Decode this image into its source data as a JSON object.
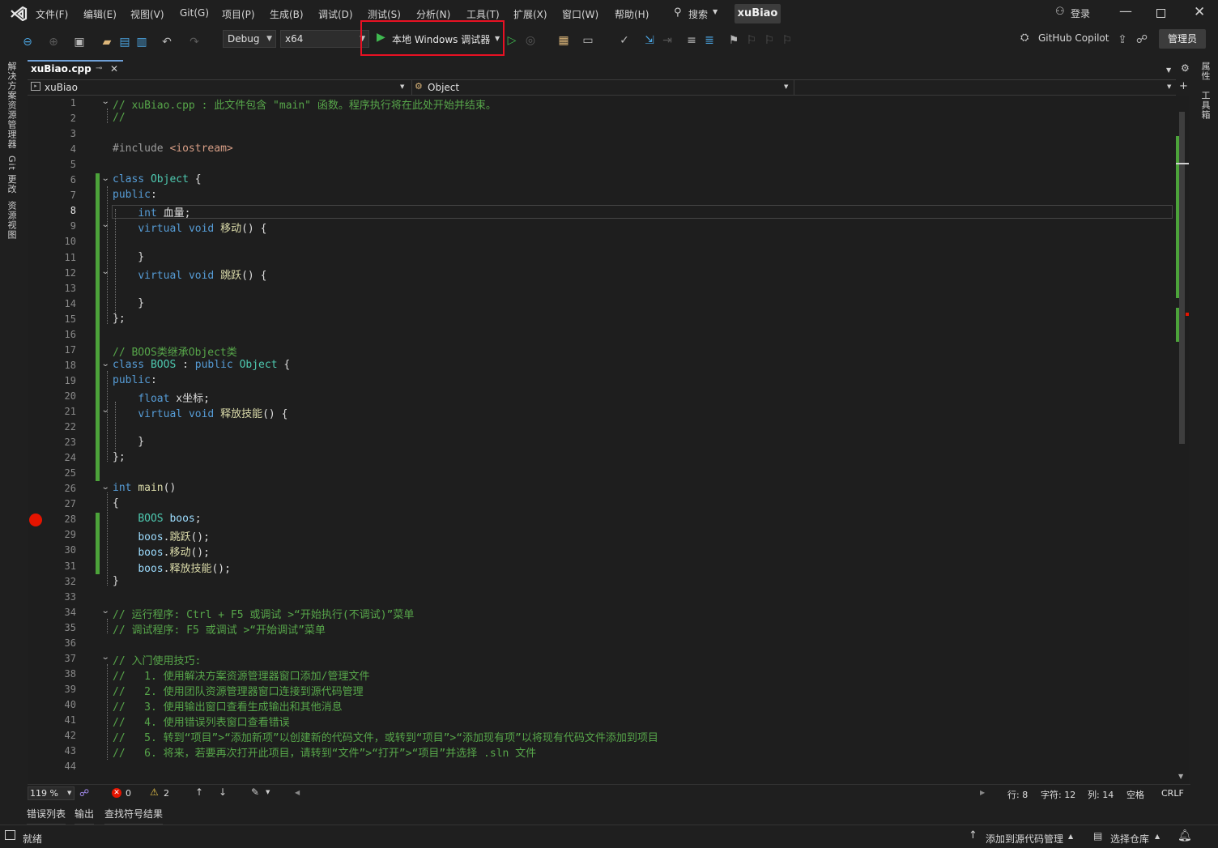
{
  "menu": {
    "items": [
      "文件(F)",
      "编辑(E)",
      "视图(V)",
      "Git(G)",
      "项目(P)",
      "生成(B)",
      "调试(D)",
      "测试(S)",
      "分析(N)",
      "工具(T)",
      "扩展(X)",
      "窗口(W)",
      "帮助(H)"
    ],
    "search_label": "搜索",
    "solution_name": "xuBiao",
    "login_label": "登录"
  },
  "toolbar": {
    "config": "Debug",
    "platform": "x64",
    "run_label": "本地 Windows 调试器",
    "copilot_label": "GitHub Copilot",
    "admin_label": "管理员",
    "highlight_color": "#e81123"
  },
  "left_rail": [
    "解决方案资源管理器",
    "Git 更改",
    "资源视图"
  ],
  "right_rail": [
    "属性",
    "工具箱"
  ],
  "doc_tab": {
    "title": "xuBiao.cpp"
  },
  "navbar": {
    "scope": "xuBiao",
    "member": "Object"
  },
  "code_lines": [
    "// xuBiao.cpp : 此文件包含 \"main\" 函数。程序执行将在此处开始并结束。",
    "//",
    "",
    "#include <iostream>",
    "",
    "class Object {",
    "public:",
    "    int 血量;",
    "    virtual void 移动() {",
    "",
    "    }",
    "    virtual void 跳跃() {",
    "",
    "    }",
    "};",
    "",
    "// BOOS类继承Object类",
    "class BOOS : public Object {",
    "public:",
    "    float x坐标;",
    "    virtual void 释放技能() {",
    "",
    "    }",
    "};",
    "",
    "int main()",
    "{",
    "    BOOS boos;",
    "    boos.跳跃();",
    "    boos.移动();",
    "    boos.释放技能();",
    "}",
    "",
    "// 运行程序: Ctrl + F5 或调试 >“开始执行(不调试)”菜单",
    "// 调试程序: F5 或调试 >“开始调试”菜单",
    "",
    "// 入门使用技巧:",
    "//   1. 使用解决方案资源管理器窗口添加/管理文件",
    "//   2. 使用团队资源管理器窗口连接到源代码管理",
    "//   3. 使用输出窗口查看生成输出和其他消息",
    "//   4. 使用错误列表窗口查看错误",
    "//   5. 转到“项目”>“添加新项”以创建新的代码文件，或转到“项目”>“添加现有项”以将现有代码文件添加到项目",
    "//   6. 将来，若要再次打开此项目，请转到“文件”>“打开”>“项目”并选择 .sln 文件",
    ""
  ],
  "line_numbers": [
    "1",
    "2",
    "3",
    "4",
    "5",
    "6",
    "7",
    "8",
    "9",
    "10",
    "11",
    "12",
    "13",
    "14",
    "15",
    "16",
    "17",
    "18",
    "19",
    "20",
    "21",
    "22",
    "23",
    "24",
    "25",
    "26",
    "27",
    "28",
    "29",
    "30",
    "31",
    "32",
    "33",
    "34",
    "35",
    "36",
    "37",
    "38",
    "39",
    "40",
    "41",
    "42",
    "43",
    "44"
  ],
  "status_line": {
    "zoom": "119 %",
    "errors": "0",
    "warnings": "2",
    "row": "行: 8",
    "char": "字符: 12",
    "col": "列: 14",
    "spaces": "空格",
    "eol": "CRLF"
  },
  "bottom_tabs": [
    "错误列表",
    "输出",
    "查找符号结果"
  ],
  "statusbar": {
    "ready": "就绪",
    "add_source": "添加到源代码管理",
    "select_repo": "选择仓库"
  },
  "breakpoint_color": "#e51400"
}
